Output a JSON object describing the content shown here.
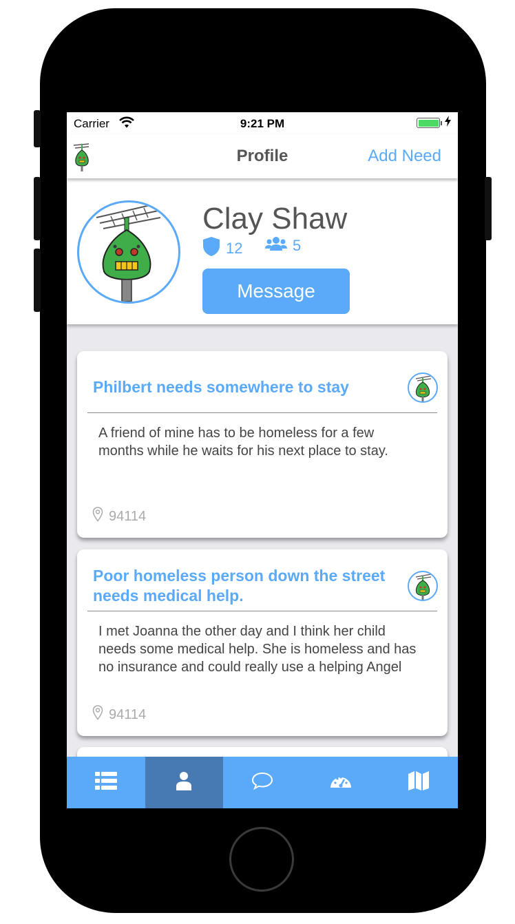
{
  "status_bar": {
    "carrier": "Carrier",
    "time": "9:21 PM",
    "battery_level": 1.0
  },
  "nav": {
    "title": "Profile",
    "add_need_label": "Add Need",
    "logo_icon": "robot-logo-icon"
  },
  "profile": {
    "name": "Clay Shaw",
    "angels_count": "12",
    "friends_count": "5",
    "message_label": "Message",
    "avatar_icon": "robot-avatar-icon"
  },
  "needs": [
    {
      "title": "Philbert needs somewhere to stay",
      "body": "A friend of mine has to be homeless for a few months while he waits for his next place to stay.",
      "zip": "94114"
    },
    {
      "title": "Poor homeless person down the street needs medical help.",
      "body": "I met Joanna the other day and I think her child needs some medical help. She is homeless and has no insurance and could really use a helping Angel",
      "zip": "94114"
    }
  ],
  "tab_bar": {
    "tabs": [
      "list-icon",
      "profile-icon",
      "chat-icon",
      "dashboard-icon",
      "map-icon"
    ],
    "active_tab": "profile-icon"
  },
  "colors": {
    "accent": "#5aaaf9",
    "tab_active": "#4779b2",
    "robot_green": "#3fae49"
  }
}
